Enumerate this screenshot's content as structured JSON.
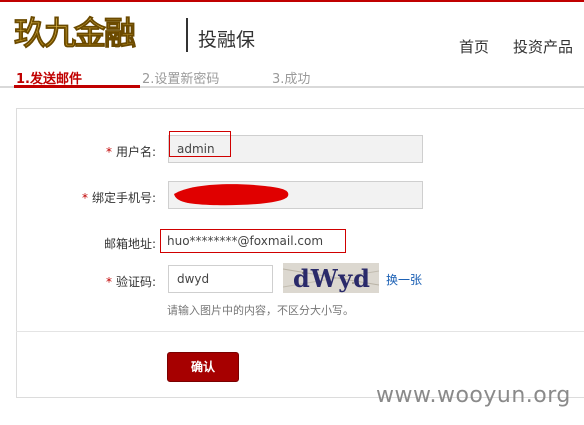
{
  "brand": {
    "logo_text": "玖九金融",
    "subtitle": "投融保"
  },
  "nav": {
    "home": "首页",
    "invest": "投资产品"
  },
  "steps": [
    {
      "label": "1.发送邮件",
      "active": true
    },
    {
      "label": "2.设置新密码",
      "active": false
    },
    {
      "label": "3.成功",
      "active": false
    }
  ],
  "form": {
    "required_mark": "*",
    "username": {
      "label": "用户名:",
      "value": "admin"
    },
    "phone": {
      "label": "绑定手机号:",
      "value": ""
    },
    "email": {
      "label": "邮箱地址:",
      "value": "huo********@foxmail.com"
    },
    "captcha": {
      "label": "验证码:",
      "value": "dwyd",
      "image_text": "dWyd",
      "refresh_label": "换一张",
      "hint": "请输入图片中的内容，不区分大小写。"
    },
    "submit_label": "确认"
  },
  "watermark": "www.wooyun.org",
  "colors": {
    "accent": "#c00000",
    "button": "#a60000",
    "link": "#1a5fb4",
    "highlight_box": "#d00000"
  }
}
